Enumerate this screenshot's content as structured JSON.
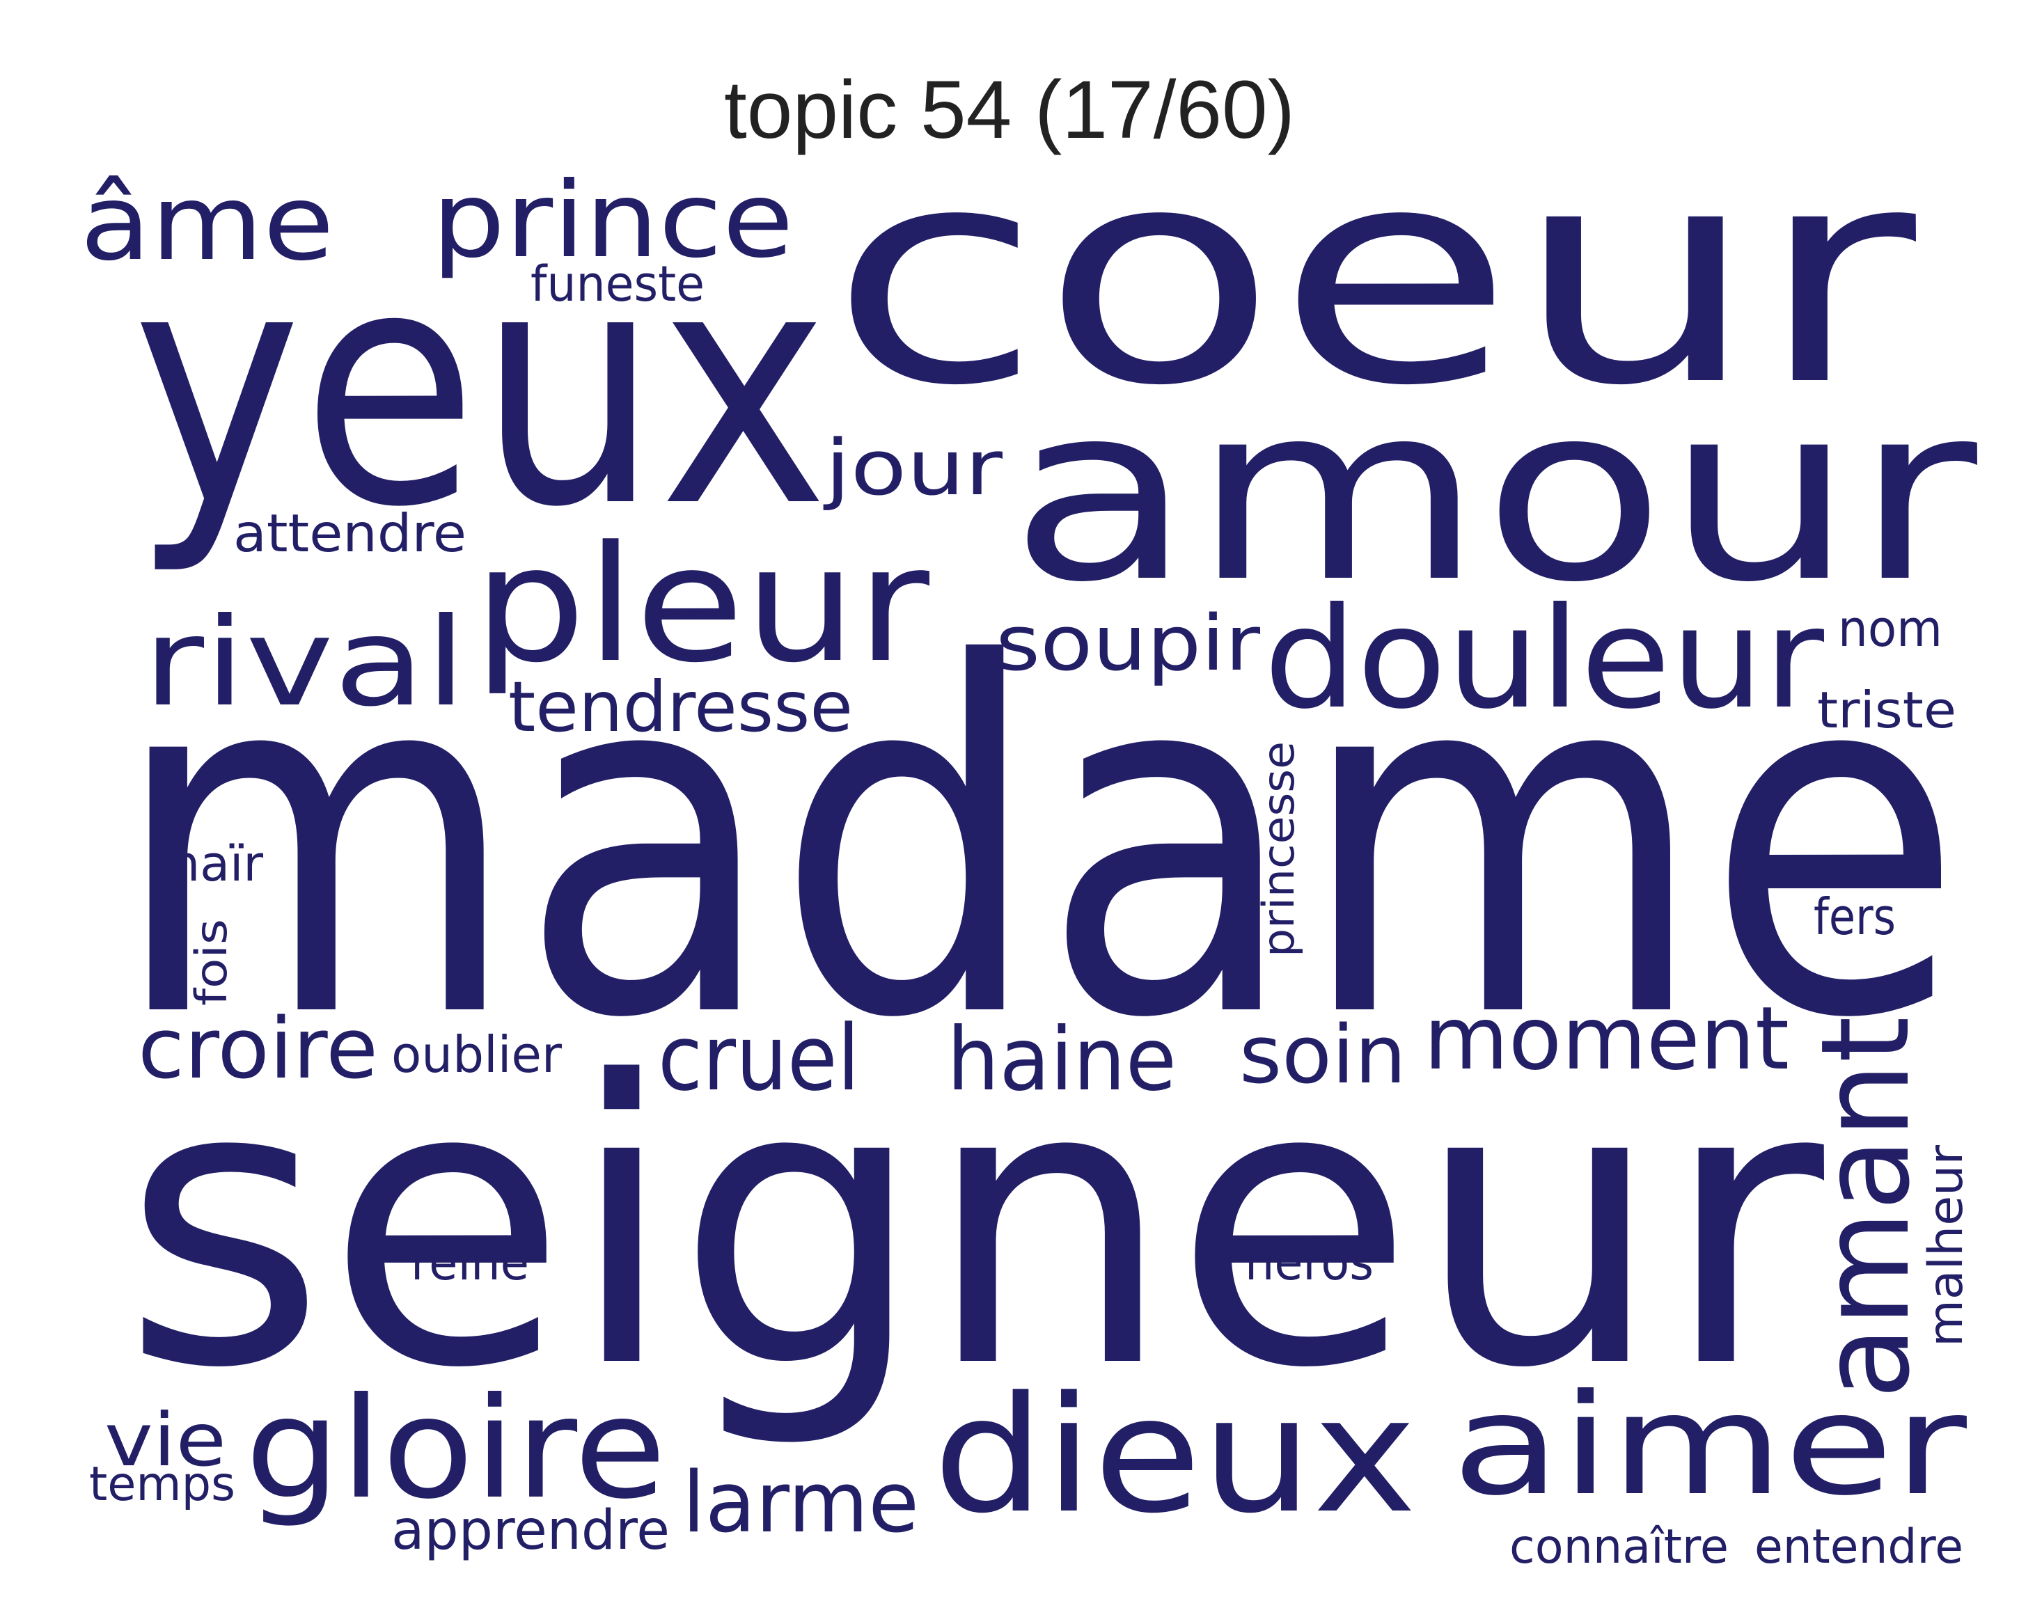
{
  "title": "topic 54 (17/60)",
  "colors": {
    "background": "#ffffff",
    "word": "#221f66",
    "title": "#222222"
  },
  "words": [
    "coeur",
    "amour",
    "yeux",
    "madame",
    "seigneur",
    "âme",
    "prince",
    "funeste",
    "jour",
    "attendre",
    "pleur",
    "rival",
    "soupir",
    "douleur",
    "nom",
    "tendresse",
    "triste",
    "princesse",
    "haïr",
    "fers",
    "fois",
    "croire",
    "oublier",
    "cruel",
    "haine",
    "soin",
    "moment",
    "amant",
    "malheur",
    "reine",
    "héros",
    "vie",
    "gloire",
    "dieux",
    "aimer",
    "temps",
    "larme",
    "apprendre",
    "connaître",
    "entendre"
  ]
}
